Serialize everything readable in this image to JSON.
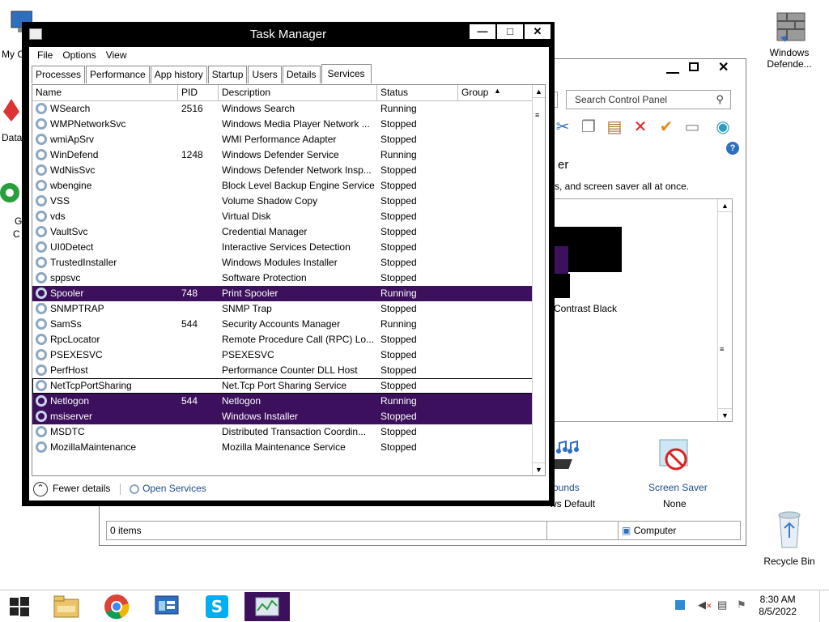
{
  "desktop": {
    "icons": {
      "my_computer": "My C",
      "data": "Data",
      "g": "G",
      "c": "C",
      "windows_defender": [
        "Windows",
        "Defende..."
      ],
      "recycle_bin": "Recycle Bin"
    }
  },
  "control_panel": {
    "search_placeholder": "Search Control Panel",
    "fragment_er": "er",
    "fragment_desc": "s, and screen saver all at once.",
    "fragment_contrast": "Contrast Black",
    "sounds_label": "ounds",
    "sounds_sub": "ws Default",
    "screen_saver_label": "Screen Saver",
    "screen_saver_sub": "None",
    "status_items": "0 items",
    "status_computer": "Computer"
  },
  "task_manager": {
    "title": "Task Manager",
    "menu": [
      "File",
      "Options",
      "View"
    ],
    "tabs": [
      "Processes",
      "Performance",
      "App history",
      "Startup",
      "Users",
      "Details",
      "Services"
    ],
    "active_tab": "Services",
    "columns": [
      "Name",
      "PID",
      "Description",
      "Status",
      "Group"
    ],
    "services": [
      {
        "name": "WSearch",
        "pid": "2516",
        "desc": "Windows Search",
        "status": "Running"
      },
      {
        "name": "WMPNetworkSvc",
        "pid": "",
        "desc": "Windows Media Player Network ...",
        "status": "Stopped"
      },
      {
        "name": "wmiApSrv",
        "pid": "",
        "desc": "WMI Performance Adapter",
        "status": "Stopped"
      },
      {
        "name": "WinDefend",
        "pid": "1248",
        "desc": "Windows Defender Service",
        "status": "Running"
      },
      {
        "name": "WdNisSvc",
        "pid": "",
        "desc": "Windows Defender Network Insp...",
        "status": "Stopped"
      },
      {
        "name": "wbengine",
        "pid": "",
        "desc": "Block Level Backup Engine Service",
        "status": "Stopped"
      },
      {
        "name": "VSS",
        "pid": "",
        "desc": "Volume Shadow Copy",
        "status": "Stopped"
      },
      {
        "name": "vds",
        "pid": "",
        "desc": "Virtual Disk",
        "status": "Stopped"
      },
      {
        "name": "VaultSvc",
        "pid": "",
        "desc": "Credential Manager",
        "status": "Stopped"
      },
      {
        "name": "UI0Detect",
        "pid": "",
        "desc": "Interactive Services Detection",
        "status": "Stopped"
      },
      {
        "name": "TrustedInstaller",
        "pid": "",
        "desc": "Windows Modules Installer",
        "status": "Stopped"
      },
      {
        "name": "sppsvc",
        "pid": "",
        "desc": "Software Protection",
        "status": "Stopped"
      },
      {
        "name": "Spooler",
        "pid": "748",
        "desc": "Print Spooler",
        "status": "Running"
      },
      {
        "name": "SNMPTRAP",
        "pid": "",
        "desc": "SNMP Trap",
        "status": "Stopped"
      },
      {
        "name": "SamSs",
        "pid": "544",
        "desc": "Security Accounts Manager",
        "status": "Running"
      },
      {
        "name": "RpcLocator",
        "pid": "",
        "desc": "Remote Procedure Call (RPC) Lo...",
        "status": "Stopped"
      },
      {
        "name": "PSEXESVC",
        "pid": "",
        "desc": "PSEXESVC",
        "status": "Stopped"
      },
      {
        "name": "PerfHost",
        "pid": "",
        "desc": "Performance Counter DLL Host",
        "status": "Stopped"
      },
      {
        "name": "NetTcpPortSharing",
        "pid": "",
        "desc": "Net.Tcp Port Sharing Service",
        "status": "Stopped"
      },
      {
        "name": "Netlogon",
        "pid": "544",
        "desc": "Netlogon",
        "status": "Running"
      },
      {
        "name": "msiserver",
        "pid": "",
        "desc": "Windows Installer",
        "status": "Stopped"
      },
      {
        "name": "MSDTC",
        "pid": "",
        "desc": "Distributed Transaction Coordin...",
        "status": "Stopped"
      },
      {
        "name": "MozillaMaintenance",
        "pid": "",
        "desc": "Mozilla Maintenance Service",
        "status": "Stopped"
      }
    ],
    "selected_rows": [
      12,
      19,
      20
    ],
    "focused_row": 18,
    "fewer_details": "Fewer details",
    "open_services": "Open Services"
  },
  "taskbar": {
    "time": "8:30 AM",
    "date": "8/5/2022"
  },
  "colors": {
    "selection": "#3c105c",
    "link": "#1a4c8c"
  }
}
